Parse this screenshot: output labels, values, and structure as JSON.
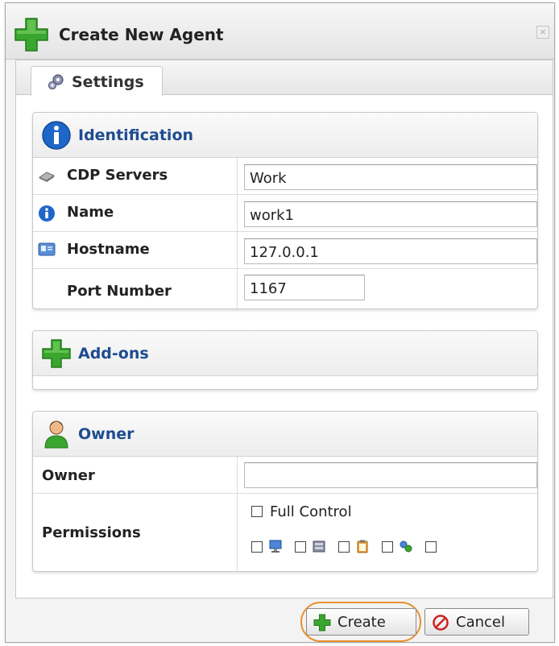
{
  "dialog": {
    "title": "Create New Agent",
    "close_symbol": "×"
  },
  "tabs": [
    {
      "label": "Settings",
      "icon": "gear-icon",
      "active": true
    }
  ],
  "identification": {
    "title": "Identification",
    "icon": "info-icon",
    "rows": {
      "cdp_servers": {
        "label": "CDP Servers",
        "value": "Work",
        "icon": "server-icon"
      },
      "name": {
        "label": "Name",
        "value": "work1",
        "icon": "info-icon"
      },
      "hostname": {
        "label": "Hostname",
        "value": "127.0.0.1",
        "icon": "host-icon"
      },
      "port": {
        "label": "Port Number",
        "value": "1167"
      }
    }
  },
  "addons": {
    "title": "Add-ons",
    "icon": "plus-icon"
  },
  "owner_panel": {
    "title": "Owner",
    "icon": "user-icon",
    "owner_label": "Owner",
    "owner_value": "",
    "permissions_label": "Permissions",
    "full_control_label": "Full Control"
  },
  "footer": {
    "create_label": "Create",
    "cancel_label": "Cancel"
  },
  "colors": {
    "accent_title": "#1e4c8f",
    "plus_green": "#3aa52f",
    "focus_ring": "#e8902e",
    "cancel_red": "#cc2222"
  }
}
